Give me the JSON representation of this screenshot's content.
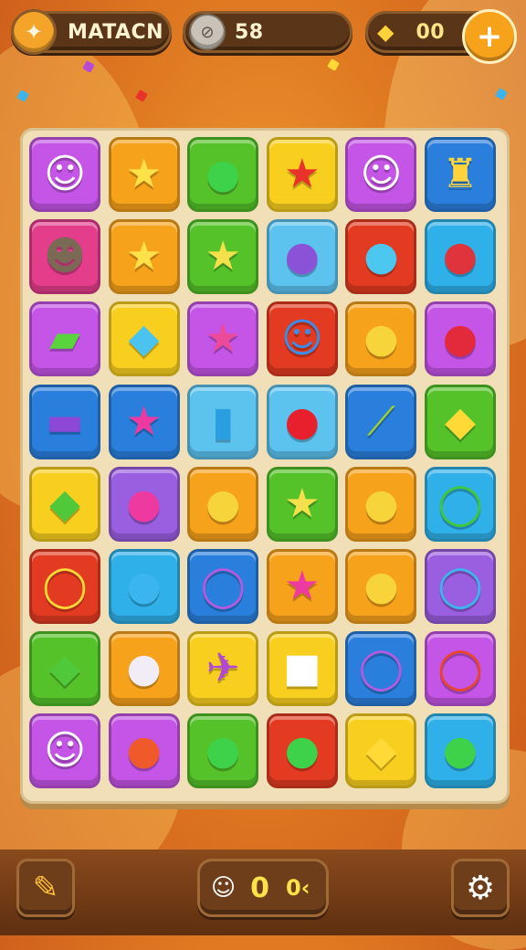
{
  "header": {
    "player_name": "MATACN",
    "coins": "58",
    "gems": "00",
    "add_label": "+"
  },
  "board": {
    "rows": 8,
    "cols": 6,
    "tiles": [
      {
        "color": "#c455e6",
        "icon": "smiling-creature",
        "glyph": "☺",
        "glyph_color": "#ffffff"
      },
      {
        "color": "#f7a21b",
        "icon": "star",
        "glyph": "★",
        "glyph_color": "#ffe14a"
      },
      {
        "color": "#55c22a",
        "icon": "green-fruit",
        "glyph": "●",
        "glyph_color": "#3ed14a"
      },
      {
        "color": "#f9cf1f",
        "icon": "red-star",
        "glyph": "★",
        "glyph_color": "#e8322a"
      },
      {
        "color": "#c455e6",
        "icon": "smiling-creature",
        "glyph": "☺",
        "glyph_color": "#ffffff"
      },
      {
        "color": "#2a7fdc",
        "icon": "yellow-crown",
        "glyph": "♜",
        "glyph_color": "#ffd43a"
      },
      {
        "color": "#e33d8c",
        "icon": "monster-creature",
        "glyph": "☻",
        "glyph_color": "#7a6a55"
      },
      {
        "color": "#f7a21b",
        "icon": "star",
        "glyph": "★",
        "glyph_color": "#ffe14a"
      },
      {
        "color": "#55c22a",
        "icon": "star-fruit",
        "glyph": "★",
        "glyph_color": "#f3e04a"
      },
      {
        "color": "#5cc3ef",
        "icon": "purple-jar",
        "glyph": "●",
        "glyph_color": "#8a52d6"
      },
      {
        "color": "#e33b22",
        "icon": "blue-bird",
        "glyph": "●",
        "glyph_color": "#4cc8f0"
      },
      {
        "color": "#2fb0e8",
        "icon": "red-berry",
        "glyph": "●",
        "glyph_color": "#e0343c"
      },
      {
        "color": "#c455e6",
        "icon": "green-potion",
        "glyph": "▰",
        "glyph_color": "#5ad43c"
      },
      {
        "color": "#f9cf1f",
        "icon": "blue-leaf",
        "glyph": "◆",
        "glyph_color": "#4ac3ee"
      },
      {
        "color": "#c455e6",
        "icon": "pink-star",
        "glyph": "★",
        "glyph_color": "#ee4a9a"
      },
      {
        "color": "#e33b22",
        "icon": "blue-creature",
        "glyph": "☺",
        "glyph_color": "#3a8de8"
      },
      {
        "color": "#f7a21b",
        "icon": "yellow-bell",
        "glyph": "●",
        "glyph_color": "#f7d53a"
      },
      {
        "color": "#c455e6",
        "icon": "red-apple",
        "glyph": "●",
        "glyph_color": "#e32a3a"
      },
      {
        "color": "#2a7fdc",
        "icon": "purple-candy",
        "glyph": "▬",
        "glyph_color": "#8e48d6"
      },
      {
        "color": "#2a7fdc",
        "icon": "pink-star",
        "glyph": "★",
        "glyph_color": "#ee3aa0"
      },
      {
        "color": "#5cc3ef",
        "icon": "blue-popsicle",
        "glyph": "▮",
        "glyph_color": "#2a9ee0"
      },
      {
        "color": "#5cc3ef",
        "icon": "red-ball",
        "glyph": "●",
        "glyph_color": "#e8202e"
      },
      {
        "color": "#2a7fdc",
        "icon": "green-banana",
        "glyph": "⟋",
        "glyph_color": "#9ed42a"
      },
      {
        "color": "#55c22a",
        "icon": "yellow-cheese",
        "glyph": "◆",
        "glyph_color": "#ffd936"
      },
      {
        "color": "#f9cf1f",
        "icon": "green-leaf",
        "glyph": "◆",
        "glyph_color": "#4fc93a"
      },
      {
        "color": "#9a5ee0",
        "icon": "pink-bell",
        "glyph": "●",
        "glyph_color": "#ee3aa0"
      },
      {
        "color": "#f7a21b",
        "icon": "yellow-bell",
        "glyph": "●",
        "glyph_color": "#f7d53a"
      },
      {
        "color": "#55c22a",
        "icon": "star-fruit",
        "glyph": "★",
        "glyph_color": "#f3e04a"
      },
      {
        "color": "#f7a21b",
        "icon": "yellow-bell",
        "glyph": "●",
        "glyph_color": "#f7d53a"
      },
      {
        "color": "#2fb0e8",
        "icon": "green-ring",
        "glyph": "◯",
        "glyph_color": "#3fc93a"
      },
      {
        "color": "#e33b22",
        "icon": "yellow-ring",
        "glyph": "◯",
        "glyph_color": "#ffd936"
      },
      {
        "color": "#2fb0e8",
        "icon": "blue-turtle",
        "glyph": "●",
        "glyph_color": "#3ab5ee"
      },
      {
        "color": "#2a7fdc",
        "icon": "purple-ring",
        "glyph": "◯",
        "glyph_color": "#b45ae0"
      },
      {
        "color": "#f7a21b",
        "icon": "pink-star",
        "glyph": "★",
        "glyph_color": "#ee3aa0"
      },
      {
        "color": "#f7a21b",
        "icon": "yellow-turtle",
        "glyph": "●",
        "glyph_color": "#f7d53a"
      },
      {
        "color": "#9a5ee0",
        "icon": "blue-ring",
        "glyph": "◯",
        "glyph_color": "#3ab5ee"
      },
      {
        "color": "#55c22a",
        "icon": "green-leaf",
        "glyph": "◆",
        "glyph_color": "#4fc93a"
      },
      {
        "color": "#f7a21b",
        "icon": "white-shell",
        "glyph": "●",
        "glyph_color": "#f2ecf7"
      },
      {
        "color": "#f9cf1f",
        "icon": "purple-plane",
        "glyph": "✈",
        "glyph_color": "#b04ad6"
      },
      {
        "color": "#f9cf1f",
        "icon": "white-cup",
        "glyph": "■",
        "glyph_color": "#ffffff"
      },
      {
        "color": "#2a7fdc",
        "icon": "purple-ring",
        "glyph": "◯",
        "glyph_color": "#b45ae0"
      },
      {
        "color": "#c455e6",
        "icon": "red-ring",
        "glyph": "◯",
        "glyph_color": "#e8452a"
      },
      {
        "color": "#c455e6",
        "icon": "white-ghost",
        "glyph": "☺",
        "glyph_color": "#ffffff"
      },
      {
        "color": "#c455e6",
        "icon": "orange-fruit",
        "glyph": "●",
        "glyph_color": "#f05a2a"
      },
      {
        "color": "#55c22a",
        "icon": "green-fruit",
        "glyph": "●",
        "glyph_color": "#3ed14a"
      },
      {
        "color": "#e33b22",
        "icon": "green-apple",
        "glyph": "●",
        "glyph_color": "#3ed14a"
      },
      {
        "color": "#f9cf1f",
        "icon": "yellow-gem",
        "glyph": "◆",
        "glyph_color": "#ffd936"
      },
      {
        "color": "#2fb0e8",
        "icon": "green-bottle",
        "glyph": "●",
        "glyph_color": "#3ed14a"
      }
    ]
  },
  "footer": {
    "moves_value": "0",
    "moves_extra": "0‹"
  }
}
